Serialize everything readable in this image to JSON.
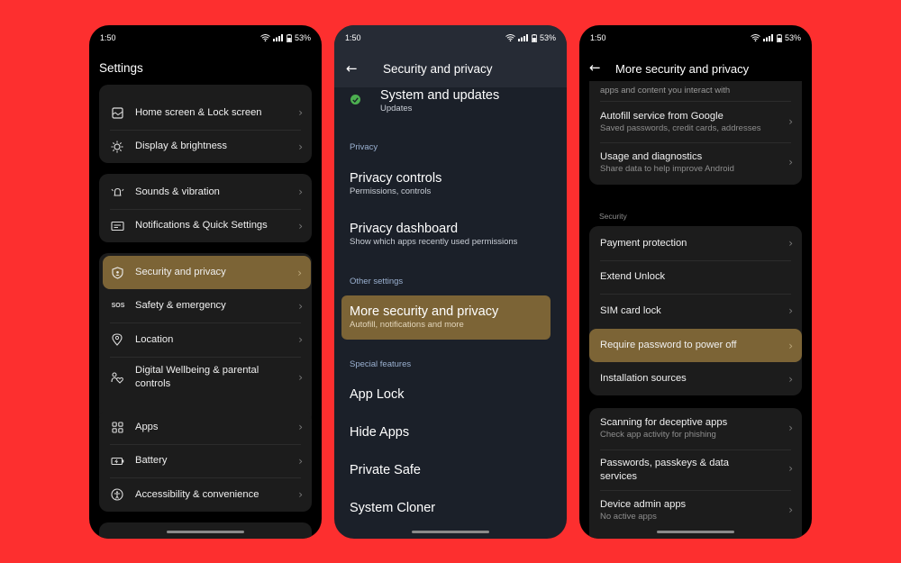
{
  "status": {
    "time": "1:50",
    "battery": "53%"
  },
  "phone1": {
    "title": "Settings",
    "group1": [
      {
        "label": "Home screen & Lock screen",
        "icon": "home-screen-icon"
      },
      {
        "label": "Display & brightness",
        "icon": "brightness-icon"
      }
    ],
    "group2": [
      {
        "label": "Sounds & vibration",
        "icon": "bell-vibration-icon"
      },
      {
        "label": "Notifications & Quick Settings",
        "icon": "notifications-icon"
      }
    ],
    "group3": [
      {
        "label": "Security and privacy",
        "icon": "shield-icon",
        "highlighted": true
      },
      {
        "label": "Safety & emergency",
        "icon": "sos-icon",
        "icon_text": "SOS"
      },
      {
        "label": "Location",
        "icon": "location-pin-icon"
      },
      {
        "label": "Digital Wellbeing & parental controls",
        "icon": "wellbeing-icon"
      }
    ],
    "group4": [
      {
        "label": "Apps",
        "icon": "apps-grid-icon"
      },
      {
        "label": "Battery",
        "icon": "battery-icon"
      },
      {
        "label": "Accessibility & convenience",
        "icon": "accessibility-icon"
      }
    ]
  },
  "phone2": {
    "title": "Security and privacy",
    "top_item": {
      "title": "System and updates",
      "subtitle": "Updates"
    },
    "sections": {
      "privacy": "Privacy",
      "other": "Other settings",
      "special": "Special features"
    },
    "privacy_items": [
      {
        "title": "Privacy controls",
        "subtitle": "Permissions, controls"
      },
      {
        "title": "Privacy dashboard",
        "subtitle": "Show which apps recently used permissions"
      }
    ],
    "other_items": [
      {
        "title": "More security and privacy",
        "subtitle": "Autofill, notifications and more",
        "highlighted": true
      }
    ],
    "special_items": [
      "App Lock",
      "Hide Apps",
      "Private Safe",
      "System Cloner"
    ]
  },
  "phone3": {
    "title": "More security and privacy",
    "top_card": {
      "partial_text": "apps and content you interact with",
      "items": [
        {
          "title": "Autofill service from Google",
          "subtitle": "Saved passwords, credit cards, addresses"
        },
        {
          "title": "Usage and diagnostics",
          "subtitle": "Share data to help improve Android"
        }
      ]
    },
    "security_label": "Security",
    "security_items": [
      {
        "title": "Payment protection"
      },
      {
        "title": "Extend Unlock"
      },
      {
        "title": "SIM card lock"
      },
      {
        "title": "Require password to power off",
        "highlighted": true
      },
      {
        "title": "Installation sources"
      }
    ],
    "bottom_items": [
      {
        "title": "Scanning for deceptive apps",
        "subtitle": "Check app activity for phishing"
      },
      {
        "title": "Passwords, passkeys & data services"
      },
      {
        "title": "Device admin apps",
        "subtitle": "No active apps"
      }
    ]
  },
  "colors": {
    "background": "#fd2f2f",
    "highlight": "#7c6436",
    "card": "#1c1c1c",
    "phone2_bg": "#1b2029"
  }
}
